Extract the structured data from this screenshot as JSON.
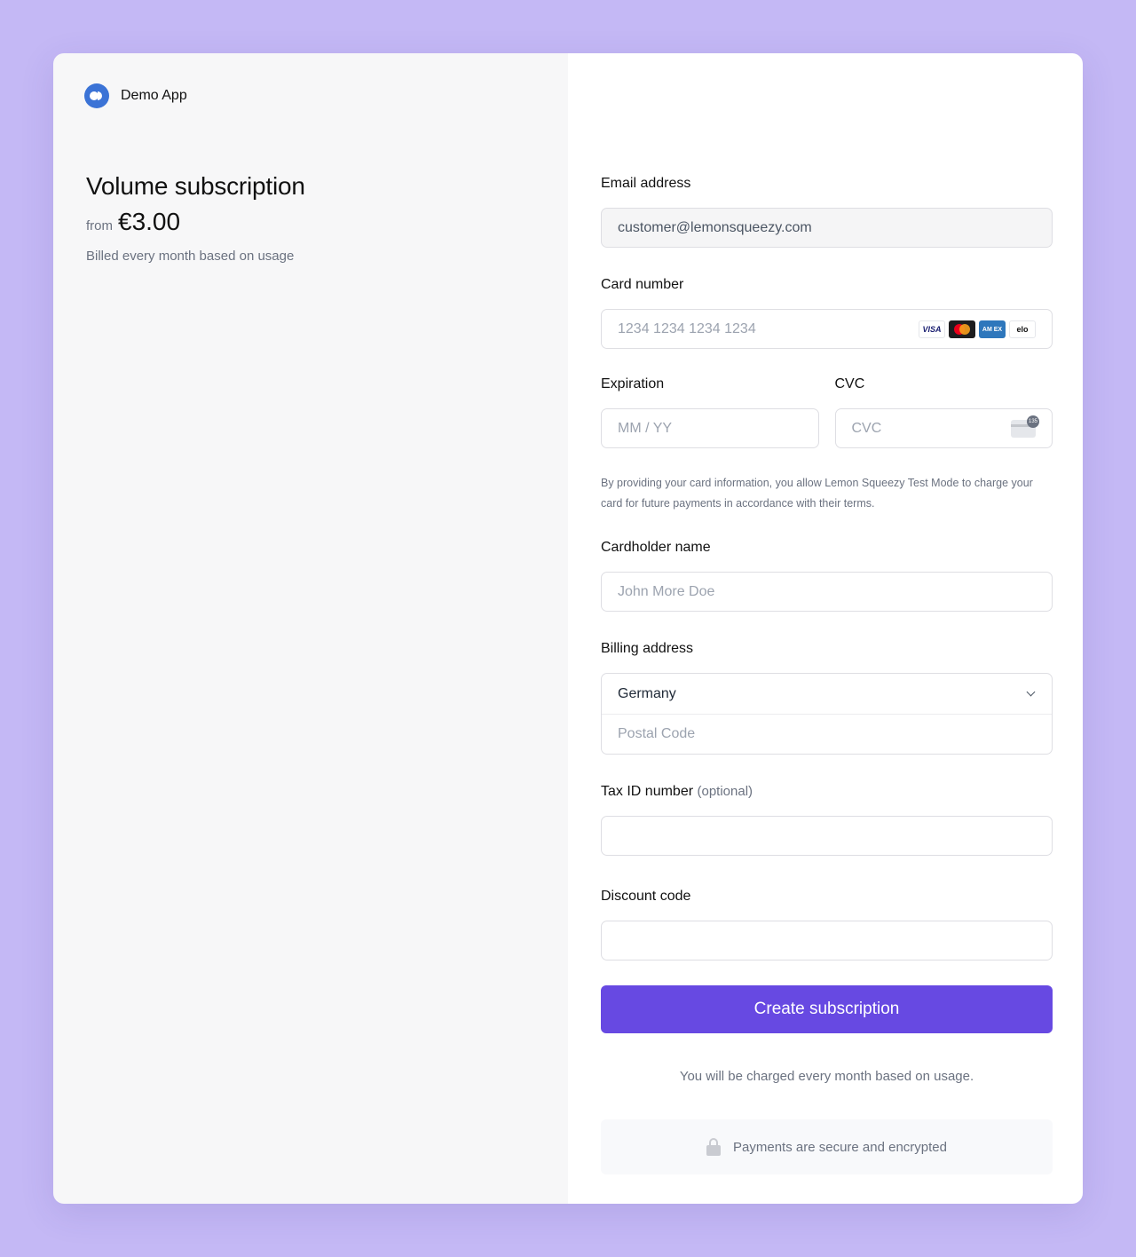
{
  "brand": {
    "name": "Demo App"
  },
  "product": {
    "title": "Volume subscription",
    "price_prefix": "from",
    "price": "€3.00",
    "billing_note": "Billed every month based on usage"
  },
  "form": {
    "email": {
      "label": "Email address",
      "value": "customer@lemonsqueezy.com"
    },
    "card_number": {
      "label": "Card number",
      "placeholder": "1234 1234 1234 1234",
      "brands": {
        "visa": "VISA",
        "amex": "AM EX",
        "elo": "elo"
      }
    },
    "expiration": {
      "label": "Expiration",
      "placeholder": "MM / YY"
    },
    "cvc": {
      "label": "CVC",
      "placeholder": "CVC",
      "icon_badge": "135"
    },
    "consent": "By providing your card information, you allow Lemon Squeezy Test Mode to charge your card for future payments in accordance with their terms.",
    "cardholder": {
      "label": "Cardholder name",
      "placeholder": "John More Doe"
    },
    "billing": {
      "label": "Billing address",
      "country": "Germany",
      "postal_placeholder": "Postal Code"
    },
    "tax_id": {
      "label": "Tax ID number",
      "optional": "(optional)",
      "value": ""
    },
    "discount": {
      "label": "Discount code",
      "value": ""
    },
    "submit_label": "Create subscription",
    "charge_note": "You will be charged every month based on usage.",
    "secure_note": "Payments are secure and encrypted"
  },
  "colors": {
    "background": "#c4b8f5",
    "accent": "#6749e2",
    "brand_logo": "#3b73d6"
  }
}
